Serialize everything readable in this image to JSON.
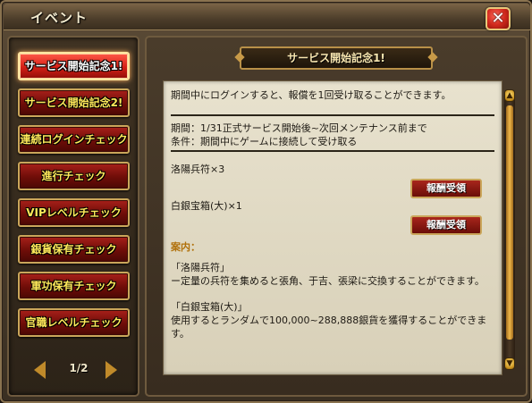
{
  "window": {
    "title": "イベント",
    "close_icon": "close-icon",
    "close_glyph": "✕"
  },
  "sidebar": {
    "items": [
      {
        "label": "サービス開始記念1!",
        "active": true
      },
      {
        "label": "サービス開始記念2!",
        "active": false
      },
      {
        "label": "連続ログインチェック",
        "active": false
      },
      {
        "label": "進行チェック",
        "active": false
      },
      {
        "label": "VIPレベルチェック",
        "active": false
      },
      {
        "label": "銀貨保有チェック",
        "active": false
      },
      {
        "label": "軍功保有チェック",
        "active": false
      },
      {
        "label": "官職レベルチェック",
        "active": false
      }
    ],
    "pager": {
      "text": "1/2"
    }
  },
  "main": {
    "header": "サービス開始記念1!",
    "intro": "期間中にログインすると、報償を1回受け取ることができます。",
    "period": "期間：1/31正式サービス開始後~次回メンテナンス前まで",
    "condition": "条件：期間中にゲームに接続して受け取る",
    "rewards": [
      {
        "item": "洛陽兵符×3",
        "button": "報酬受領"
      },
      {
        "item": "白銀宝箱(大)×1",
        "button": "報酬受領"
      }
    ],
    "guide_label": "案内：",
    "guide": [
      {
        "title": "「洛陽兵符」",
        "body": "ー定量の兵符を集めると張角、于吉、張梁に交換することができます。"
      },
      {
        "title": "「白銀宝箱(大)」",
        "body": "使用するとランダムで100,000~288,888銀貨を獲得することができます。"
      }
    ]
  },
  "colors": {
    "accent_red": "#d41f16",
    "gold_border": "#caa65a",
    "guide_label": "#b0700a"
  }
}
